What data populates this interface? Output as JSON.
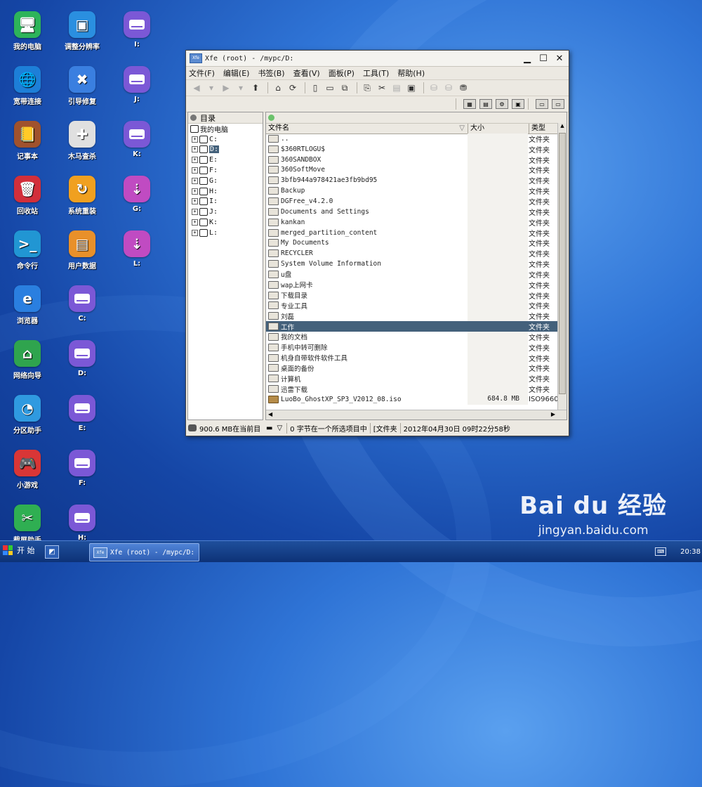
{
  "desktop": {
    "col1": [
      {
        "label": "我的电脑",
        "icon": "monitor-icon",
        "color": "#2db45a",
        "glyph": "🖥"
      },
      {
        "label": "宽带连接",
        "icon": "globe-icon",
        "color": "#1d7fd8",
        "glyph": "🌐"
      },
      {
        "label": "记事本",
        "icon": "notebook-icon",
        "color": "#a0522d",
        "glyph": "📒"
      },
      {
        "label": "回收站",
        "icon": "trash-icon",
        "color": "#d22f3a",
        "glyph": "🗑"
      },
      {
        "label": "命令行",
        "icon": "terminal-icon",
        "color": "#2196d3",
        "glyph": ">_"
      },
      {
        "label": "浏览器",
        "icon": "browser-icon",
        "color": "#2a7fe0",
        "glyph": "e"
      },
      {
        "label": "网络向导",
        "icon": "home-icon",
        "color": "#2fa44e",
        "glyph": "⌂"
      },
      {
        "label": "分区助手",
        "icon": "piechart-icon",
        "color": "#2f9ae0",
        "glyph": "◔"
      },
      {
        "label": "小游戏",
        "icon": "gamepad-icon",
        "color": "#d93636",
        "glyph": "🎮"
      },
      {
        "label": "截屏助手",
        "icon": "scissors-icon",
        "color": "#2faf52",
        "glyph": "✂"
      }
    ],
    "col2": [
      {
        "label": "调整分辨率",
        "icon": "resolution-icon",
        "color": "#2a8fe0",
        "glyph": "▣"
      },
      {
        "label": "引导修复",
        "icon": "tools-icon",
        "color": "#3a7fe0",
        "glyph": "✖"
      },
      {
        "label": "木马查杀",
        "icon": "medkit-icon",
        "color": "#e0e0e0",
        "glyph": "✚"
      },
      {
        "label": "系统重装",
        "icon": "reinstall-icon",
        "color": "#f0a020",
        "glyph": "↻"
      },
      {
        "label": "用户数据",
        "icon": "folder-icon",
        "color": "#e8902a",
        "glyph": "▤"
      },
      {
        "label": "C:",
        "icon": "drive-icon",
        "color": "#7b58d6"
      },
      {
        "label": "D:",
        "icon": "drive-icon",
        "color": "#7b58d6"
      },
      {
        "label": "E:",
        "icon": "drive-icon",
        "color": "#7b58d6"
      },
      {
        "label": "F:",
        "icon": "drive-icon",
        "color": "#7b58d6"
      },
      {
        "label": "H:",
        "icon": "drive-icon",
        "color": "#7b58d6"
      }
    ],
    "col3": [
      {
        "label": "I:",
        "icon": "drive-icon"
      },
      {
        "label": "J:",
        "icon": "drive-icon"
      },
      {
        "label": "K:",
        "icon": "drive-icon"
      },
      {
        "label": "G:",
        "icon": "usb-icon"
      },
      {
        "label": "L:",
        "icon": "usb-icon"
      }
    ]
  },
  "window": {
    "title": "Xfe (root) - /mypc/D:",
    "menu": [
      "文件(F)",
      "编辑(E)",
      "书签(B)",
      "查看(V)",
      "面板(P)",
      "工具(T)",
      "帮助(H)"
    ],
    "tree_header": "目录",
    "tree": [
      {
        "label": "我的电脑",
        "level": 0
      },
      {
        "label": "C:",
        "level": 1
      },
      {
        "label": "D:",
        "level": 1,
        "selected": true
      },
      {
        "label": "E:",
        "level": 1
      },
      {
        "label": "F:",
        "level": 1
      },
      {
        "label": "G:",
        "level": 1
      },
      {
        "label": "H:",
        "level": 1
      },
      {
        "label": "I:",
        "level": 1
      },
      {
        "label": "J:",
        "level": 1
      },
      {
        "label": "K:",
        "level": 1
      },
      {
        "label": "L:",
        "level": 1
      }
    ],
    "left_status": "900.6 MB在当前目",
    "columns": {
      "name": "文件名",
      "size": "大小",
      "type": "类型"
    },
    "files": [
      {
        "name": "..",
        "size": "",
        "type": "文件夹"
      },
      {
        "name": "$360RTLOGU$",
        "size": "",
        "type": "文件夹"
      },
      {
        "name": "360SANDBOX",
        "size": "",
        "type": "文件夹"
      },
      {
        "name": "360SoftMove",
        "size": "",
        "type": "文件夹"
      },
      {
        "name": "3bfb944a978421ae3fb9bd95",
        "size": "",
        "type": "文件夹"
      },
      {
        "name": "Backup",
        "size": "",
        "type": "文件夹"
      },
      {
        "name": "DGFree_v4.2.0",
        "size": "",
        "type": "文件夹"
      },
      {
        "name": "Documents and Settings",
        "size": "",
        "type": "文件夹"
      },
      {
        "name": "kankan",
        "size": "",
        "type": "文件夹"
      },
      {
        "name": "merged_partition_content",
        "size": "",
        "type": "文件夹"
      },
      {
        "name": "My Documents",
        "size": "",
        "type": "文件夹"
      },
      {
        "name": "RECYCLER",
        "size": "",
        "type": "文件夹"
      },
      {
        "name": "System Volume Information",
        "size": "",
        "type": "文件夹"
      },
      {
        "name": "u盘",
        "size": "",
        "type": "文件夹"
      },
      {
        "name": "wap上网卡",
        "size": "",
        "type": "文件夹"
      },
      {
        "name": "下载目录",
        "size": "",
        "type": "文件夹"
      },
      {
        "name": "专业工具",
        "size": "",
        "type": "文件夹"
      },
      {
        "name": "刘磊",
        "size": "",
        "type": "文件夹"
      },
      {
        "name": "工作",
        "size": "",
        "type": "文件夹",
        "selected": true
      },
      {
        "name": "我的文档",
        "size": "",
        "type": "文件夹"
      },
      {
        "name": "手机中转可删除",
        "size": "",
        "type": "文件夹"
      },
      {
        "name": "机身自带软件软件工具",
        "size": "",
        "type": "文件夹"
      },
      {
        "name": "桌面的备份",
        "size": "",
        "type": "文件夹"
      },
      {
        "name": "计算机",
        "size": "",
        "type": "文件夹"
      },
      {
        "name": "迅雷下载",
        "size": "",
        "type": "文件夹"
      },
      {
        "name": "LuoBo_GhostXP_SP3_V2012_08.iso",
        "size": "684.8 MB",
        "type": "ISO9660"
      }
    ],
    "status": {
      "selection": "0 字节在一个所选项目中",
      "type": "[文件夹",
      "date": "2012年04月30日 09时22分58秒"
    }
  },
  "taskbar": {
    "start_label": "开 始",
    "task_title": "Xfe (root) - /mypc/D:",
    "clock": "20:38"
  },
  "watermark": {
    "brand": "Bai du 经验",
    "url": "jingyan.baidu.com"
  }
}
